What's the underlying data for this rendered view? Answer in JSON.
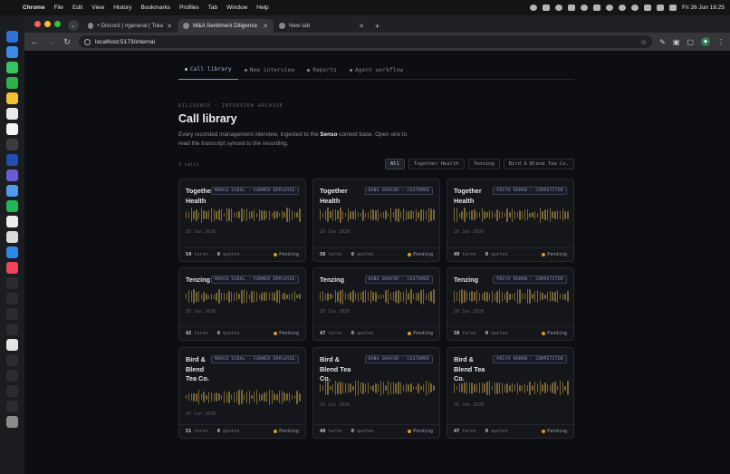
{
  "menubar": {
    "app": "Chrome",
    "items": [
      "File",
      "Edit",
      "View",
      "History",
      "Bookmarks",
      "Profiles",
      "Tab",
      "Window",
      "Help"
    ],
    "clock": "Fri 26 Jun  16:25"
  },
  "browser": {
    "tabs": [
      {
        "label": "• Discord | #general | Token…",
        "active": false
      },
      {
        "label": "M&A Sentiment Diligence",
        "active": true
      },
      {
        "label": "New tab",
        "active": false
      }
    ],
    "url": "localhost:5173/internal"
  },
  "app": {
    "nav": [
      {
        "label": "Call library",
        "active": true
      },
      {
        "label": "New interview",
        "active": false
      },
      {
        "label": "Reports",
        "active": false
      },
      {
        "label": "Agent workflow",
        "active": false
      }
    ],
    "eyebrow": "DILIGENCE · INTERVIEW ARCHIVE",
    "title": "Call library",
    "desc_pre": "Every recorded management interview, ingested to the ",
    "desc_bold": "Senso",
    "desc_post": " context base. Open one to read the transcript synced to the recording.",
    "count": "9 calls",
    "filters": [
      {
        "label": "All",
        "active": true
      },
      {
        "label": "Together Health",
        "active": false
      },
      {
        "label": "Tenzing",
        "active": false
      },
      {
        "label": "Bird & Blend Tea Co.",
        "active": false
      }
    ],
    "turns_label": "turns",
    "quotes_label": "quotes",
    "cards": [
      {
        "company": "Together Health",
        "person": "MARCO VIDAL · FORMER EMPLOYEE",
        "date": "26 Jun 2026",
        "turns": "54",
        "quotes": "0",
        "status": "Pending"
      },
      {
        "company": "Together Health",
        "person": "DANA OKAFOR · CUSTOMER",
        "date": "26 Jun 2026",
        "turns": "50",
        "quotes": "0",
        "status": "Pending"
      },
      {
        "company": "Together Health",
        "person": "PRIYA RAMAN · COMPETITOR",
        "date": "26 Jun 2026",
        "turns": "49",
        "quotes": "0",
        "status": "Pending"
      },
      {
        "company": "Tenzing",
        "person": "MARCO VIDAL · FORMER EMPLOYEE",
        "date": "26 Jun 2026",
        "turns": "42",
        "quotes": "0",
        "status": "Pending"
      },
      {
        "company": "Tenzing",
        "person": "DANA OKAFOR · CUSTOMER",
        "date": "26 Jun 2026",
        "turns": "47",
        "quotes": "0",
        "status": "Pending"
      },
      {
        "company": "Tenzing",
        "person": "PRIYA RAMAN · COMPETITOR",
        "date": "26 Jun 2026",
        "turns": "50",
        "quotes": "0",
        "status": "Pending"
      },
      {
        "company": "Bird & Blend Tea Co.",
        "person": "MARCO VIDAL · FORMER EMPLOYEE",
        "date": "26 Jun 2026",
        "turns": "51",
        "quotes": "0",
        "status": "Pending"
      },
      {
        "company": "Bird & Blend Tea Co.",
        "person": "DANA OKAFOR · CUSTOMER",
        "date": "26 Jun 2026",
        "turns": "48",
        "quotes": "0",
        "status": "Pending"
      },
      {
        "company": "Bird & Blend Tea Co.",
        "person": "PRIYA RAMAN · COMPETITOR",
        "date": "26 Jun 2026",
        "turns": "47",
        "quotes": "0",
        "status": "Pending"
      }
    ]
  },
  "colors": {
    "accent": "#7e9ac2",
    "pending": "#d69a2b",
    "waveform": "#7a6634"
  }
}
